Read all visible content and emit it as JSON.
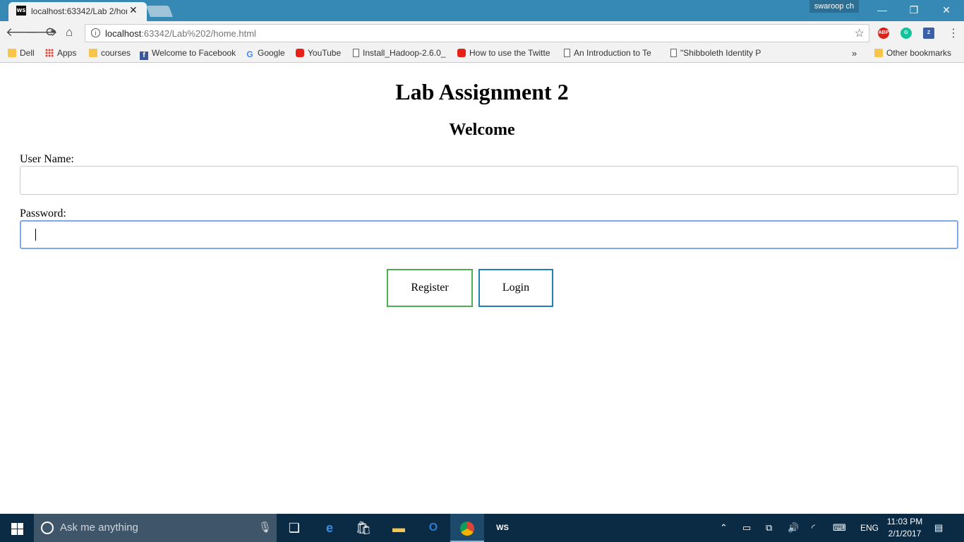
{
  "browser": {
    "tab_title": "localhost:63342/Lab 2/home.html",
    "tab_favicon": "WS",
    "profile_name": "swaroop ch",
    "url_host": "localhost",
    "url_path": ":63342/Lab%202/home.html",
    "extensions": [
      {
        "name": "adblock-plus-icon",
        "label": "ABP",
        "color": "#d9241c"
      },
      {
        "name": "grammarly-icon",
        "label": "G",
        "color": "#15c39a"
      },
      {
        "name": "zotero-icon",
        "label": "Z",
        "color": "#3b5fa8"
      }
    ]
  },
  "bookmarks": {
    "items": [
      {
        "label": "Dell",
        "icon": "folder"
      },
      {
        "label": "Apps",
        "icon": "apps"
      },
      {
        "label": "courses",
        "icon": "folder"
      },
      {
        "label": "Welcome to Facebook",
        "icon": "facebook"
      },
      {
        "label": "Google",
        "icon": "google"
      },
      {
        "label": "YouTube",
        "icon": "youtube"
      },
      {
        "label": "Install_Hadoop-2.6.0_",
        "icon": "document"
      },
      {
        "label": "How to use the Twitte",
        "icon": "youtube"
      },
      {
        "label": "An Introduction to Te",
        "icon": "document"
      },
      {
        "label": "\"Shibboleth Identity P",
        "icon": "document"
      }
    ],
    "overflow": "»",
    "other": "Other bookmarks"
  },
  "page": {
    "title": "Lab Assignment 2",
    "subtitle": "Welcome",
    "username_label": "User Name:",
    "username_value": "",
    "password_label": "Password:",
    "password_value": "",
    "register_button": "Register",
    "login_button": "Login"
  },
  "taskbar": {
    "search_placeholder": "Ask me anything",
    "language": "ENG",
    "time": "11:03 PM",
    "date": "2/1/2017"
  }
}
